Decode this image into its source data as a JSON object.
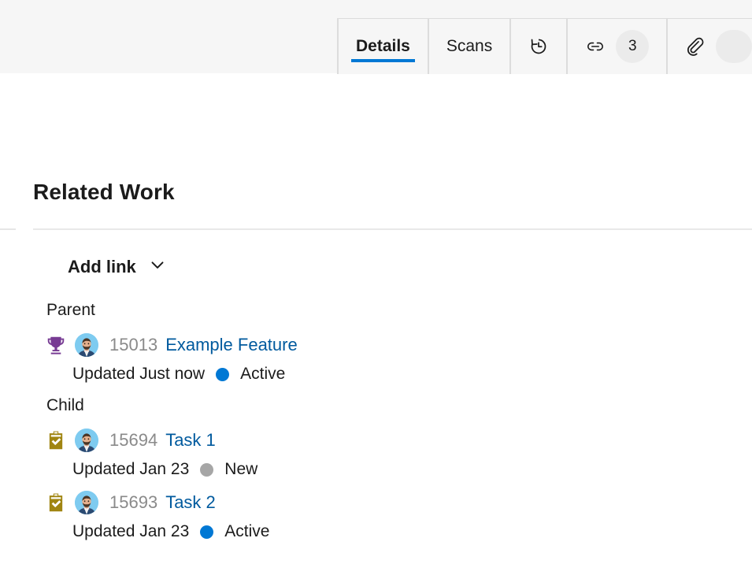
{
  "tabbar": {
    "tabs": [
      {
        "label": "Details",
        "icon": "",
        "badge": "",
        "active": true,
        "name": "tab-details"
      },
      {
        "label": "Scans",
        "icon": "",
        "badge": "",
        "active": false,
        "name": "tab-scans"
      },
      {
        "label": "",
        "icon": "history-icon",
        "badge": "",
        "active": false,
        "name": "tab-history"
      },
      {
        "label": "",
        "icon": "link-icon",
        "badge": "3",
        "active": false,
        "name": "tab-links"
      },
      {
        "label": "",
        "icon": "attachment-icon",
        "badge": "",
        "active": false,
        "name": "tab-attachments"
      }
    ]
  },
  "panel": {
    "title": "Related Work",
    "add_link_label": "Add link",
    "add_link_icon": "chevron-down-icon"
  },
  "colors": {
    "accent": "#0078d4",
    "link": "#005a9e",
    "feature_icon": "#773b93",
    "task_icon": "#a08511",
    "state_active": "#0078d4",
    "state_new": "#a6a6a6",
    "id_text": "#8a8a8a",
    "tabbar_bg": "#f6f6f6",
    "badge_bg": "#ebebeb"
  },
  "groups": [
    {
      "label": "Parent",
      "items": [
        {
          "icon": "trophy-icon",
          "icon_type": "feature",
          "avatar": "person-avatar",
          "id": "15013",
          "title": "Example Feature",
          "updated": "Updated Just now",
          "state": "Active",
          "state_color": "#0078d4"
        }
      ]
    },
    {
      "label": "Child",
      "items": [
        {
          "icon": "task-clipboard-icon",
          "icon_type": "task",
          "avatar": "person-avatar",
          "id": "15694",
          "title": "Task 1",
          "updated": "Updated Jan 23",
          "state": "New",
          "state_color": "#a6a6a6"
        },
        {
          "icon": "task-clipboard-icon",
          "icon_type": "task",
          "avatar": "person-avatar",
          "id": "15693",
          "title": "Task 2",
          "updated": "Updated Jan 23",
          "state": "Active",
          "state_color": "#0078d4"
        }
      ]
    }
  ]
}
